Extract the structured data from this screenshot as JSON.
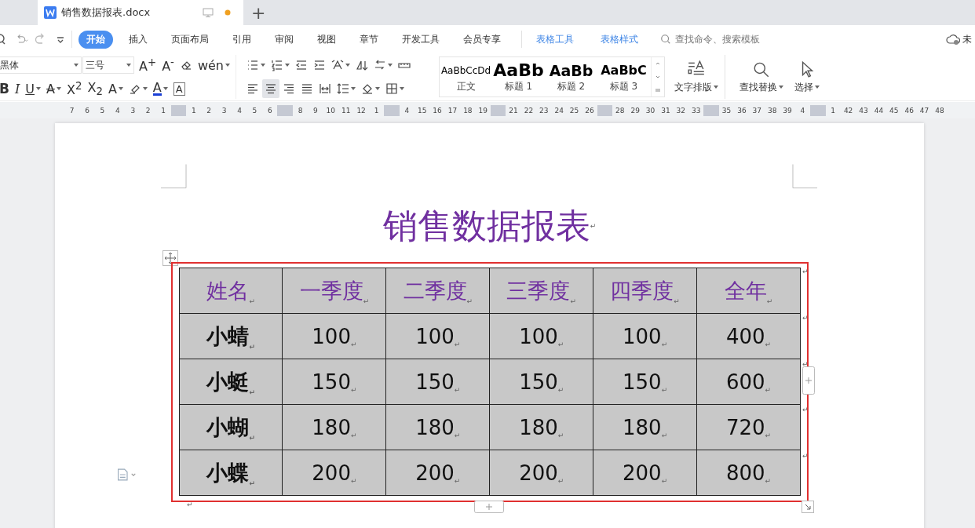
{
  "doc_tabs": [
    {
      "title": "销售数据报表.docx",
      "selected": true,
      "unsaved": true
    }
  ],
  "new_tab": "+",
  "menu": {
    "tabs": [
      {
        "label": "开始",
        "selected": true,
        "kind": "main"
      },
      {
        "label": "插入",
        "selected": false,
        "kind": "main"
      },
      {
        "label": "页面布局",
        "selected": false,
        "kind": "main"
      },
      {
        "label": "引用",
        "selected": false,
        "kind": "main"
      },
      {
        "label": "审阅",
        "selected": false,
        "kind": "main"
      },
      {
        "label": "视图",
        "selected": false,
        "kind": "main"
      },
      {
        "label": "章节",
        "selected": false,
        "kind": "main"
      },
      {
        "label": "开发工具",
        "selected": false,
        "kind": "main"
      },
      {
        "label": "会员专享",
        "selected": false,
        "kind": "main"
      },
      {
        "label": "表格工具",
        "selected": false,
        "kind": "context"
      },
      {
        "label": "表格样式",
        "selected": false,
        "kind": "context"
      }
    ],
    "search_placeholder": "查找命令、搜索模板",
    "sync": "未"
  },
  "font": {
    "name": "黑体",
    "size": "三号"
  },
  "format_row1": [
    {
      "kind": "glyph",
      "label": "A$^{+}$",
      "dropdown": false
    },
    {
      "kind": "glyph",
      "label": "A$^{-}$",
      "dropdown": false
    },
    {
      "kind": "eraser",
      "dropdown": false
    },
    {
      "kind": "glyph",
      "label": "wén",
      "dropdown": true
    }
  ],
  "format_row2": [
    {
      "kind": "bold",
      "label": "B",
      "dropdown": false
    },
    {
      "kind": "italic",
      "label": "I",
      "dropdown": false
    },
    {
      "kind": "underline",
      "label": "U",
      "dropdown": true
    },
    {
      "kind": "strike",
      "label": "A",
      "dropdown": true
    },
    {
      "kind": "glyph",
      "label": "X$^{2}$",
      "dropdown": false
    },
    {
      "kind": "glyph",
      "label": "X$_{2}$",
      "dropdown": false
    },
    {
      "kind": "glyph",
      "label": "A",
      "dropdown": true
    },
    {
      "kind": "highlighter",
      "dropdown": true
    },
    {
      "kind": "color",
      "label": "A",
      "dropdown": true
    },
    {
      "kind": "boxed",
      "label": "A",
      "dropdown": false
    }
  ],
  "paragraph_row1": [
    {
      "kind": "bullets",
      "dropdown": true,
      "selected": false
    },
    {
      "kind": "numbering",
      "dropdown": true,
      "selected": false
    },
    {
      "kind": "outdent",
      "dropdown": false,
      "selected": false
    },
    {
      "kind": "indent",
      "dropdown": false,
      "selected": false
    },
    {
      "kind": "asian",
      "dropdown": true,
      "selected": false
    },
    {
      "kind": "sort",
      "dropdown": false,
      "selected": false
    },
    {
      "kind": "linebreak",
      "dropdown": true,
      "selected": false
    },
    {
      "kind": "ruler",
      "dropdown": false,
      "selected": false
    }
  ],
  "paragraph_row2": [
    {
      "kind": "align-left",
      "dropdown": false,
      "selected": false
    },
    {
      "kind": "align-center",
      "dropdown": false,
      "selected": true
    },
    {
      "kind": "align-right",
      "dropdown": false,
      "selected": false
    },
    {
      "kind": "justify",
      "dropdown": false,
      "selected": false
    },
    {
      "kind": "distribute",
      "dropdown": false,
      "selected": false
    },
    {
      "kind": "line-spacing",
      "dropdown": true,
      "selected": false
    },
    {
      "kind": "shading",
      "dropdown": true,
      "selected": false
    },
    {
      "kind": "borders",
      "dropdown": true,
      "selected": false
    }
  ],
  "styles": [
    {
      "kind": "body",
      "preview": "AaBbCcDd",
      "label": "正文"
    },
    {
      "kind": "h1",
      "preview": "AaBb",
      "label": "标题 1"
    },
    {
      "kind": "h2",
      "preview": "AaBb",
      "label": "标题 2"
    },
    {
      "kind": "h3",
      "preview": "AaBbC",
      "label": "标题 3"
    }
  ],
  "big_buttons": [
    {
      "kind": "layout",
      "label": "文字排版",
      "dropdown": true
    },
    {
      "kind": "find",
      "label": "查找替换",
      "dropdown": true
    },
    {
      "kind": "select",
      "label": "选择",
      "dropdown": true
    }
  ],
  "ruler": [
    {
      "kind": "num",
      "label": "7"
    },
    {
      "kind": "num",
      "label": "6"
    },
    {
      "kind": "num",
      "label": "5"
    },
    {
      "kind": "num",
      "label": "4"
    },
    {
      "kind": "num",
      "label": "3"
    },
    {
      "kind": "num",
      "label": "2"
    },
    {
      "kind": "num",
      "label": "1"
    },
    {
      "kind": "marker"
    },
    {
      "kind": "num",
      "label": "1"
    },
    {
      "kind": "num",
      "label": "2"
    },
    {
      "kind": "num",
      "label": "3"
    },
    {
      "kind": "num",
      "label": "4"
    },
    {
      "kind": "num",
      "label": "5"
    },
    {
      "kind": "num",
      "label": "6"
    },
    {
      "kind": "marker"
    },
    {
      "kind": "num",
      "label": "8"
    },
    {
      "kind": "num",
      "label": "9"
    },
    {
      "kind": "num",
      "label": "10"
    },
    {
      "kind": "num",
      "label": "11"
    },
    {
      "kind": "num",
      "label": "12"
    },
    {
      "kind": "num",
      "label": "1"
    },
    {
      "kind": "marker"
    },
    {
      "kind": "num",
      "label": "4"
    },
    {
      "kind": "num",
      "label": "15"
    },
    {
      "kind": "num",
      "label": "16"
    },
    {
      "kind": "num",
      "label": "17"
    },
    {
      "kind": "num",
      "label": "18"
    },
    {
      "kind": "num",
      "label": "19"
    },
    {
      "kind": "marker"
    },
    {
      "kind": "num",
      "label": "21"
    },
    {
      "kind": "num",
      "label": "22"
    },
    {
      "kind": "num",
      "label": "23"
    },
    {
      "kind": "num",
      "label": "24"
    },
    {
      "kind": "num",
      "label": "25"
    },
    {
      "kind": "num",
      "label": "26"
    },
    {
      "kind": "marker"
    },
    {
      "kind": "num",
      "label": "28"
    },
    {
      "kind": "num",
      "label": "29"
    },
    {
      "kind": "num",
      "label": "30"
    },
    {
      "kind": "num",
      "label": "31"
    },
    {
      "kind": "num",
      "label": "32"
    },
    {
      "kind": "num",
      "label": "33"
    },
    {
      "kind": "marker"
    },
    {
      "kind": "num",
      "label": "35"
    },
    {
      "kind": "num",
      "label": "36"
    },
    {
      "kind": "num",
      "label": "37"
    },
    {
      "kind": "num",
      "label": "38"
    },
    {
      "kind": "num",
      "label": "39"
    },
    {
      "kind": "num",
      "label": "4"
    },
    {
      "kind": "marker"
    },
    {
      "kind": "num",
      "label": "1"
    },
    {
      "kind": "num",
      "label": "42"
    },
    {
      "kind": "num",
      "label": "43"
    },
    {
      "kind": "num",
      "label": "44"
    },
    {
      "kind": "num",
      "label": "45"
    },
    {
      "kind": "num",
      "label": "46"
    },
    {
      "kind": "num",
      "label": "47"
    },
    {
      "kind": "num",
      "label": "48"
    }
  ],
  "document": {
    "title": "销售数据报表",
    "title_mark": "↵",
    "table": {
      "header": [
        {
          "text": "姓名",
          "mark": "↵"
        },
        {
          "text": "一季度",
          "mark": "↵"
        },
        {
          "text": "二季度",
          "mark": "↵"
        },
        {
          "text": "三季度",
          "mark": "↵"
        },
        {
          "text": "四季度",
          "mark": "↵"
        },
        {
          "text": "全年",
          "mark": "↵"
        }
      ],
      "header_end_mark": "↵",
      "rows": [
        {
          "cells": [
            {
              "text": "小蜻",
              "mark": "↵"
            },
            {
              "text": "100",
              "mark": "↵"
            },
            {
              "text": "100",
              "mark": "↵"
            },
            {
              "text": "100",
              "mark": "↵"
            },
            {
              "text": "100",
              "mark": "↵"
            },
            {
              "text": "400",
              "mark": "↵"
            }
          ],
          "end_mark": "↵"
        },
        {
          "cells": [
            {
              "text": "小蜓",
              "mark": "↵"
            },
            {
              "text": "150",
              "mark": "↵"
            },
            {
              "text": "150",
              "mark": "↵"
            },
            {
              "text": "150",
              "mark": "↵"
            },
            {
              "text": "150",
              "mark": "↵"
            },
            {
              "text": "600",
              "mark": "↵"
            }
          ],
          "end_mark": "↵"
        },
        {
          "cells": [
            {
              "text": "小蝴",
              "mark": "↵"
            },
            {
              "text": "180",
              "mark": "↵"
            },
            {
              "text": "180",
              "mark": "↵"
            },
            {
              "text": "180",
              "mark": "↵"
            },
            {
              "text": "180",
              "mark": "↵"
            },
            {
              "text": "720",
              "mark": "↵"
            }
          ],
          "end_mark": "↵"
        },
        {
          "cells": [
            {
              "text": "小蝶",
              "mark": "↵"
            },
            {
              "text": "200",
              "mark": "↵"
            },
            {
              "text": "200",
              "mark": "↵"
            },
            {
              "text": "200",
              "mark": "↵"
            },
            {
              "text": "200",
              "mark": "↵"
            },
            {
              "text": "800",
              "mark": "↵"
            }
          ],
          "end_mark": "↵"
        }
      ],
      "selected": true
    },
    "after_mark": "↵"
  }
}
